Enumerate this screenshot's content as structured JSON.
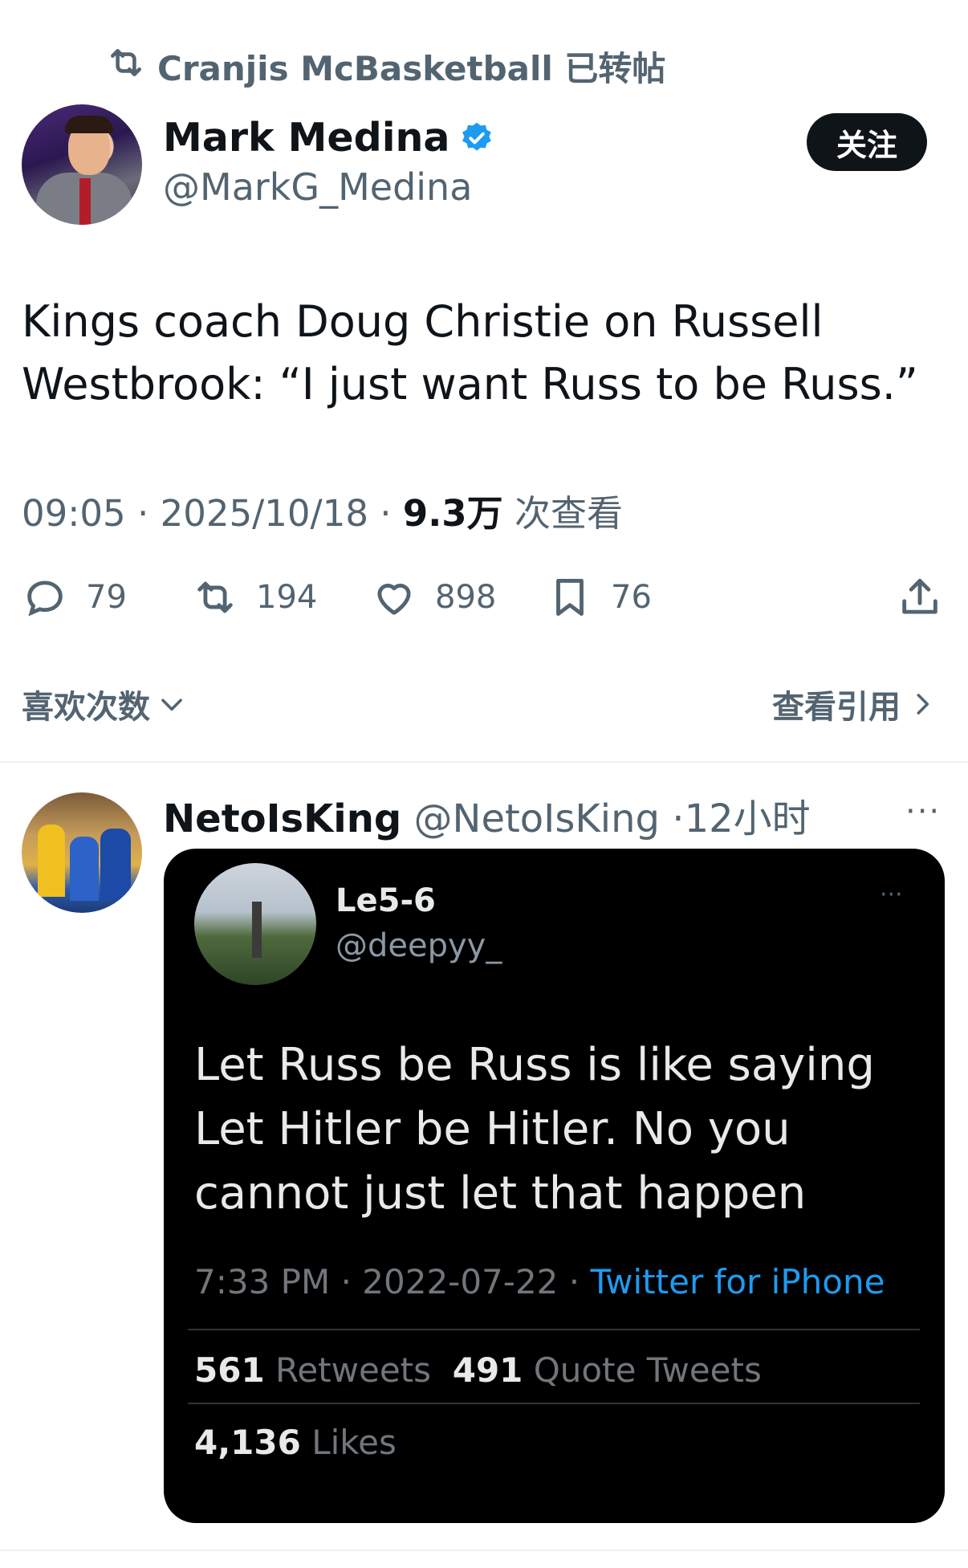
{
  "repost": {
    "text": "Cranjis McBasketball 已转帖",
    "icon": "repost-icon"
  },
  "tweet": {
    "display_name": "Mark Medina",
    "handle": "@MarkG_Medina",
    "follow_label": "关注",
    "text": "Kings coach Doug Christie on Russell Westbrook: “I just want Russ to be Russ.”",
    "time": "09:05",
    "date": "2025/10/18",
    "views_count": "9.3万",
    "views_label": "次查看",
    "stats": {
      "replies": "79",
      "retweets": "194",
      "likes": "898",
      "bookmarks": "76"
    },
    "likes_link": "喜欢次数",
    "quotes_link": "查看引用"
  },
  "reply": {
    "display_name": "NetoIsKing",
    "handle": "@NetoIsKing",
    "time": "12小时",
    "more": "···",
    "embedded": {
      "display_name": "Le5-6",
      "handle": "@deepyy_",
      "more": "···",
      "text": "Let Russ be Russ is like saying Let Hitler be Hitler. No you cannot just let that happen",
      "time": "7:33 PM",
      "date": "2022-07-22",
      "source": "Twitter for iPhone",
      "retweets_count": "561",
      "retweets_label": "Retweets",
      "quotes_count": "491",
      "quotes_label": "Quote Tweets",
      "likes_count": "4,136",
      "likes_label": "Likes"
    }
  },
  "colors": {
    "text": "#0f1419",
    "muted": "#536471",
    "verified": "#1d9bf0",
    "card_bg": "#000000"
  }
}
